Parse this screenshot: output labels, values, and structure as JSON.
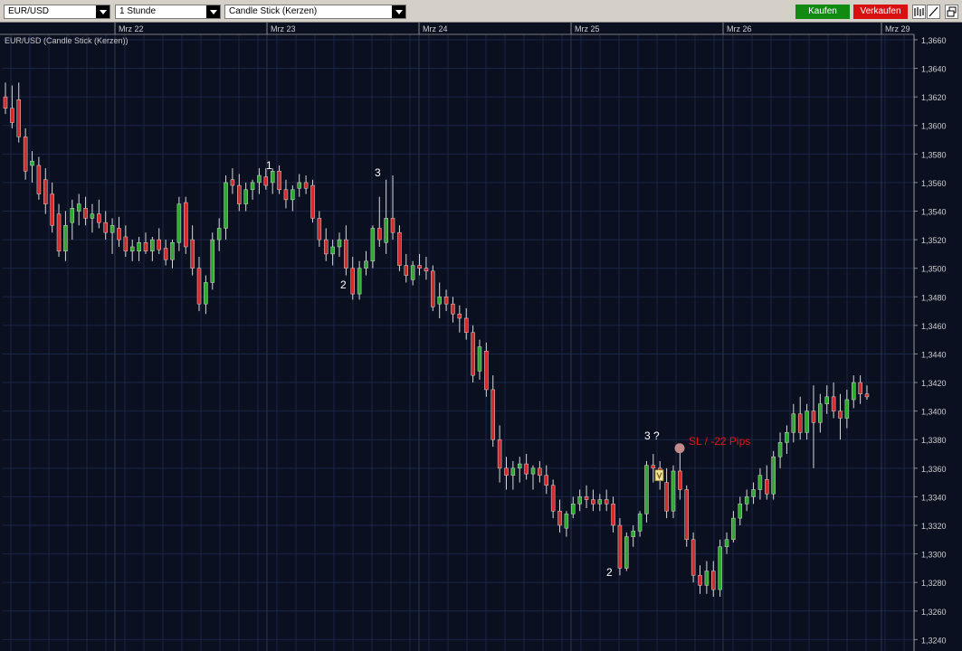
{
  "toolbar": {
    "symbol": "EUR/USD",
    "timeframe": "1 Stunde",
    "chart_type": "Candle Stick (Kerzen)",
    "buy_label": "Kaufen",
    "sell_label": "Verkaufen",
    "buy_color": "#128a12",
    "sell_color": "#d91010"
  },
  "chart": {
    "title": "EUR/USD (Candle Stick (Kerzen))",
    "background": "#0b1021",
    "up_color": "#2eaa2e",
    "down_color": "#d42a2a",
    "x_labels": [
      "Mrz 22",
      "Mrz 23",
      "Mrz 24",
      "Mrz 25",
      "Mrz 26",
      "Mrz 29"
    ],
    "y_labels": [
      "1,3660",
      "1,3640",
      "1,3620",
      "1,3600",
      "1,3580",
      "1,3560",
      "1,3540",
      "1,3520",
      "1,3500",
      "1,3480",
      "1,3460",
      "1,3440",
      "1,3420",
      "1,3400",
      "1,3380",
      "1,3360",
      "1,3340",
      "1,3320",
      "1,3300",
      "1,3280",
      "1,3260",
      "1,3240"
    ]
  },
  "annotations": [
    {
      "id": "a1",
      "text": "1"
    },
    {
      "id": "a2",
      "text": "2"
    },
    {
      "id": "a3",
      "text": "3"
    },
    {
      "id": "a4",
      "text": "2"
    },
    {
      "id": "a5",
      "text": "3 ?"
    }
  ],
  "stop_loss": {
    "label": "SL / -22 Pips",
    "color": "#e01818",
    "price": 1.3374
  },
  "chart_data": {
    "type": "candlestick",
    "title": "EUR/USD (Candle Stick (Kerzen))",
    "xlabel": "",
    "ylabel": "",
    "ylim": [
      1.3232,
      1.3672
    ],
    "x_ticks": [
      "Mrz 22",
      "Mrz 23",
      "Mrz 24",
      "Mrz 25",
      "Mrz 26",
      "Mrz 29"
    ],
    "grid": true,
    "ohlc": [
      [
        1.362,
        1.363,
        1.3608,
        1.3612
      ],
      [
        1.3612,
        1.3628,
        1.3598,
        1.3602
      ],
      [
        1.3618,
        1.363,
        1.3588,
        1.3592
      ],
      [
        1.3592,
        1.3598,
        1.3562,
        1.3568
      ],
      [
        1.3572,
        1.3582,
        1.356,
        1.3575
      ],
      [
        1.3572,
        1.3578,
        1.3548,
        1.3552
      ],
      [
        1.3562,
        1.357,
        1.3538,
        1.3545
      ],
      [
        1.3552,
        1.356,
        1.3525,
        1.353
      ],
      [
        1.3538,
        1.3545,
        1.3508,
        1.3512
      ],
      [
        1.3512,
        1.354,
        1.3505,
        1.353
      ],
      [
        1.3532,
        1.3548,
        1.352,
        1.3542
      ],
      [
        1.354,
        1.3552,
        1.353,
        1.3545
      ],
      [
        1.3542,
        1.355,
        1.353,
        1.3535
      ],
      [
        1.3535,
        1.3545,
        1.3525,
        1.3538
      ],
      [
        1.3538,
        1.3548,
        1.3528,
        1.3532
      ],
      [
        1.3532,
        1.354,
        1.352,
        1.3525
      ],
      [
        1.3525,
        1.3535,
        1.351,
        1.353
      ],
      [
        1.3528,
        1.3536,
        1.3515,
        1.352
      ],
      [
        1.3522,
        1.353,
        1.3508,
        1.3512
      ],
      [
        1.3512,
        1.352,
        1.3505,
        1.3515
      ],
      [
        1.3512,
        1.3522,
        1.3505,
        1.3518
      ],
      [
        1.3518,
        1.3525,
        1.351,
        1.3512
      ],
      [
        1.3512,
        1.3522,
        1.3505,
        1.352
      ],
      [
        1.352,
        1.3528,
        1.351,
        1.3513
      ],
      [
        1.3514,
        1.352,
        1.3502,
        1.3506
      ],
      [
        1.3506,
        1.352,
        1.35,
        1.3518
      ],
      [
        1.3518,
        1.355,
        1.3512,
        1.3545
      ],
      [
        1.3546,
        1.355,
        1.351,
        1.3515
      ],
      [
        1.352,
        1.353,
        1.3495,
        1.35
      ],
      [
        1.35,
        1.3508,
        1.347,
        1.3475
      ],
      [
        1.3475,
        1.3495,
        1.3468,
        1.349
      ],
      [
        1.349,
        1.3525,
        1.3485,
        1.352
      ],
      [
        1.352,
        1.3535,
        1.3512,
        1.3528
      ],
      [
        1.3528,
        1.3565,
        1.352,
        1.356
      ],
      [
        1.3562,
        1.357,
        1.3552,
        1.3558
      ],
      [
        1.3558,
        1.3566,
        1.354,
        1.3545
      ],
      [
        1.3545,
        1.356,
        1.354,
        1.3555
      ],
      [
        1.3555,
        1.3562,
        1.3548,
        1.356
      ],
      [
        1.356,
        1.357,
        1.3552,
        1.3565
      ],
      [
        1.3564,
        1.357,
        1.3555,
        1.3558
      ],
      [
        1.356,
        1.357,
        1.3552,
        1.3568
      ],
      [
        1.3568,
        1.3572,
        1.3552,
        1.3555
      ],
      [
        1.3555,
        1.3562,
        1.3542,
        1.3548
      ],
      [
        1.3548,
        1.3558,
        1.354,
        1.3555
      ],
      [
        1.3556,
        1.3566,
        1.355,
        1.356
      ],
      [
        1.356,
        1.3565,
        1.3552,
        1.3556
      ],
      [
        1.3558,
        1.3562,
        1.3532,
        1.3535
      ],
      [
        1.3535,
        1.354,
        1.3515,
        1.352
      ],
      [
        1.352,
        1.3528,
        1.3505,
        1.351
      ],
      [
        1.351,
        1.352,
        1.3502,
        1.3515
      ],
      [
        1.3515,
        1.3525,
        1.3508,
        1.352
      ],
      [
        1.352,
        1.353,
        1.3495,
        1.35
      ],
      [
        1.35,
        1.3508,
        1.3478,
        1.3482
      ],
      [
        1.3482,
        1.3505,
        1.3478,
        1.35
      ],
      [
        1.35,
        1.3512,
        1.3495,
        1.3505
      ],
      [
        1.3505,
        1.353,
        1.35,
        1.3528
      ],
      [
        1.3528,
        1.355,
        1.3515,
        1.352
      ],
      [
        1.3518,
        1.3562,
        1.351,
        1.3535
      ],
      [
        1.3535,
        1.3565,
        1.352,
        1.3525
      ],
      [
        1.3525,
        1.353,
        1.3498,
        1.3502
      ],
      [
        1.3502,
        1.351,
        1.349,
        1.3495
      ],
      [
        1.3492,
        1.3505,
        1.3488,
        1.3502
      ],
      [
        1.3502,
        1.351,
        1.3495,
        1.35
      ],
      [
        1.35,
        1.3508,
        1.3492,
        1.3498
      ],
      [
        1.3498,
        1.3502,
        1.347,
        1.3473
      ],
      [
        1.3475,
        1.349,
        1.3465,
        1.348
      ],
      [
        1.348,
        1.3485,
        1.347,
        1.3475
      ],
      [
        1.3475,
        1.348,
        1.3462,
        1.3468
      ],
      [
        1.3468,
        1.3474,
        1.3455,
        1.3465
      ],
      [
        1.3465,
        1.3472,
        1.345,
        1.3455
      ],
      [
        1.3455,
        1.346,
        1.342,
        1.3425
      ],
      [
        1.3428,
        1.345,
        1.3422,
        1.3445
      ],
      [
        1.3442,
        1.3448,
        1.341,
        1.3415
      ],
      [
        1.3415,
        1.3425,
        1.3375,
        1.338
      ],
      [
        1.338,
        1.339,
        1.335,
        1.336
      ],
      [
        1.336,
        1.3368,
        1.3345,
        1.3355
      ],
      [
        1.3355,
        1.3365,
        1.3345,
        1.336
      ],
      [
        1.336,
        1.3368,
        1.335,
        1.3363
      ],
      [
        1.3363,
        1.337,
        1.3352,
        1.3356
      ],
      [
        1.3356,
        1.3362,
        1.3345,
        1.336
      ],
      [
        1.336,
        1.3365,
        1.335,
        1.3355
      ],
      [
        1.3355,
        1.3362,
        1.3342,
        1.3348
      ],
      [
        1.3348,
        1.3352,
        1.3325,
        1.333
      ],
      [
        1.333,
        1.3338,
        1.3315,
        1.332
      ],
      [
        1.3318,
        1.333,
        1.3312,
        1.3328
      ],
      [
        1.3328,
        1.334,
        1.3325,
        1.3335
      ],
      [
        1.3335,
        1.3345,
        1.333,
        1.334
      ],
      [
        1.334,
        1.3348,
        1.3332,
        1.3338
      ],
      [
        1.3338,
        1.3345,
        1.333,
        1.3335
      ],
      [
        1.3335,
        1.3342,
        1.333,
        1.3338
      ],
      [
        1.3338,
        1.3345,
        1.333,
        1.3335
      ],
      [
        1.3335,
        1.334,
        1.3315,
        1.332
      ],
      [
        1.332,
        1.3325,
        1.3285,
        1.329
      ],
      [
        1.329,
        1.3315,
        1.3288,
        1.3312
      ],
      [
        1.3312,
        1.332,
        1.3305,
        1.3316
      ],
      [
        1.3316,
        1.333,
        1.3312,
        1.3328
      ],
      [
        1.3328,
        1.3365,
        1.3322,
        1.3362
      ],
      [
        1.3362,
        1.337,
        1.335,
        1.336
      ],
      [
        1.336,
        1.3365,
        1.3345,
        1.3352
      ],
      [
        1.335,
        1.336,
        1.3325,
        1.333
      ],
      [
        1.333,
        1.3362,
        1.3325,
        1.3358
      ],
      [
        1.3358,
        1.3372,
        1.3338,
        1.3345
      ],
      [
        1.3345,
        1.3348,
        1.3305,
        1.331
      ],
      [
        1.331,
        1.3315,
        1.328,
        1.3285
      ],
      [
        1.3285,
        1.3292,
        1.3272,
        1.3278
      ],
      [
        1.3278,
        1.3295,
        1.3272,
        1.3288
      ],
      [
        1.3288,
        1.3295,
        1.327,
        1.3275
      ],
      [
        1.3275,
        1.331,
        1.327,
        1.3305
      ],
      [
        1.3305,
        1.3315,
        1.33,
        1.331
      ],
      [
        1.331,
        1.333,
        1.3308,
        1.3325
      ],
      [
        1.3325,
        1.334,
        1.332,
        1.3335
      ],
      [
        1.3335,
        1.3345,
        1.333,
        1.334
      ],
      [
        1.334,
        1.335,
        1.3335,
        1.3345
      ],
      [
        1.3345,
        1.336,
        1.3338,
        1.3355
      ],
      [
        1.3352,
        1.3362,
        1.3338,
        1.3342
      ],
      [
        1.3342,
        1.3372,
        1.3338,
        1.3368
      ],
      [
        1.3368,
        1.3385,
        1.336,
        1.3378
      ],
      [
        1.3378,
        1.339,
        1.337,
        1.3385
      ],
      [
        1.3385,
        1.3405,
        1.3378,
        1.3398
      ],
      [
        1.3398,
        1.341,
        1.338,
        1.3385
      ],
      [
        1.3385,
        1.3405,
        1.338,
        1.34
      ],
      [
        1.34,
        1.3418,
        1.336,
        1.3392
      ],
      [
        1.3392,
        1.3412,
        1.3385,
        1.3405
      ],
      [
        1.3405,
        1.3418,
        1.3398,
        1.341
      ],
      [
        1.341,
        1.342,
        1.3395,
        1.34
      ],
      [
        1.34,
        1.3412,
        1.338,
        1.3395
      ],
      [
        1.3395,
        1.3415,
        1.3388,
        1.3408
      ],
      [
        1.3408,
        1.3425,
        1.3402,
        1.342
      ],
      [
        1.342,
        1.3425,
        1.3405,
        1.3412
      ],
      [
        1.3412,
        1.3418,
        1.3408,
        1.341
      ]
    ]
  }
}
